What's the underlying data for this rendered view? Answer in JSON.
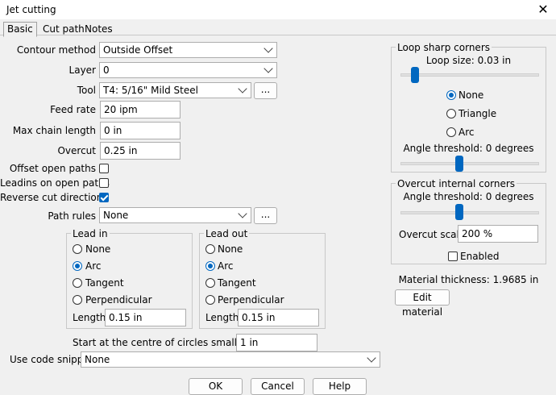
{
  "window": {
    "title": "Jet cutting",
    "close_glyph": "✕"
  },
  "tabs": [
    {
      "label": "Basic",
      "active": true
    },
    {
      "label": "Cut path"
    },
    {
      "label": "Notes"
    }
  ],
  "form": {
    "contour_method": {
      "label": "Contour method",
      "value": "Outside Offset"
    },
    "layer": {
      "label": "Layer",
      "value": "0"
    },
    "tool": {
      "label": "Tool",
      "value": "T4: 5/16\" Mild Steel",
      "browse": "..."
    },
    "feed_rate": {
      "label": "Feed rate",
      "value": "20 ipm"
    },
    "max_chain_length": {
      "label": "Max chain length",
      "value": "0 in"
    },
    "overcut": {
      "label": "Overcut",
      "value": "0.25 in"
    },
    "offset_open_paths": {
      "label": "Offset open paths",
      "checked": false
    },
    "leadins_open_paths": {
      "label": "Leadins on open paths",
      "checked": false
    },
    "reverse_cut": {
      "label": "Reverse cut direction",
      "checked": true
    },
    "path_rules": {
      "label": "Path rules",
      "value": "None",
      "browse": "..."
    }
  },
  "lead_in": {
    "title": "Lead in",
    "options": [
      "None",
      "Arc",
      "Tangent",
      "Perpendicular"
    ],
    "selected": "Arc",
    "length_label": "Length",
    "length_value": "0.15 in"
  },
  "lead_out": {
    "title": "Lead out",
    "options": [
      "None",
      "Arc",
      "Tangent",
      "Perpendicular"
    ],
    "selected": "Arc",
    "length_label": "Length",
    "length_value": "0.15 in"
  },
  "start_centre": {
    "label": "Start at the centre of circles smaller than",
    "value": "1 in"
  },
  "code_snippet": {
    "label": "Use code snippet",
    "value": "None"
  },
  "loop_corners": {
    "title": "Loop sharp corners",
    "loop_size_label": "Loop size: 0.03 in",
    "loop_size_slider": 0.08,
    "options": [
      "None",
      "Triangle",
      "Arc"
    ],
    "selected": "None",
    "angle_label": "Angle threshold: 0 degrees",
    "angle_slider": 0.42
  },
  "overcut_corners": {
    "title": "Overcut internal corners",
    "angle_label": "Angle threshold: 0 degrees",
    "angle_slider": 0.42,
    "scale_label": "Overcut scale",
    "scale_value": "200 %",
    "enabled_label": "Enabled",
    "enabled": false
  },
  "material": {
    "thickness_label": "Material thickness: 1.9685 in",
    "edit_label": "Edit material"
  },
  "footer": {
    "ok": "OK",
    "cancel": "Cancel",
    "help": "Help"
  }
}
